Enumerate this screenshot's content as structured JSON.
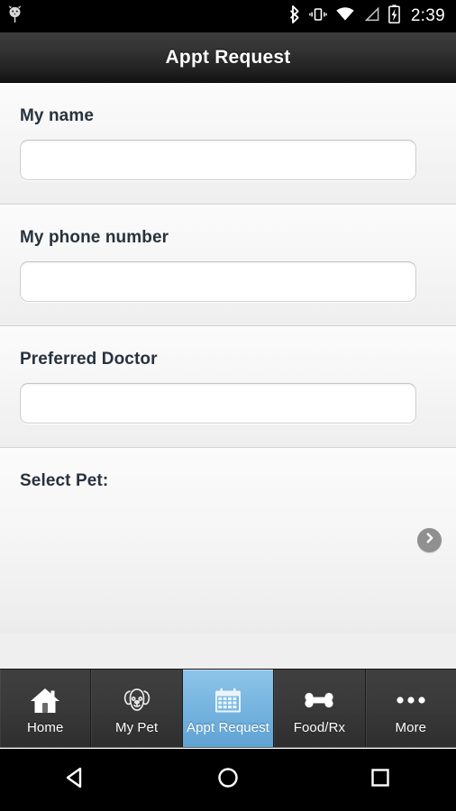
{
  "statusbar": {
    "notification_icon": "app-notification-icon",
    "icons": [
      "bluetooth-icon",
      "vibrate-icon",
      "wifi-icon",
      "cell-signal-icon",
      "battery-charging-icon"
    ],
    "time": "2:39"
  },
  "titlebar": {
    "title": "Appt Request"
  },
  "form": {
    "sections": [
      {
        "label": "My name",
        "value": "",
        "placeholder": ""
      },
      {
        "label": "My phone number",
        "value": "",
        "placeholder": ""
      },
      {
        "label": "Preferred Doctor",
        "value": "",
        "placeholder": ""
      }
    ],
    "select_pet": {
      "label": "Select Pet:",
      "arrow_icon": "chevron-right-icon"
    }
  },
  "tabbar": {
    "active_color": "#7ab8e2",
    "tabs": [
      {
        "label": "Home",
        "icon": "home-icon",
        "active": false
      },
      {
        "label": "My Pet",
        "icon": "dog-face-icon",
        "active": false
      },
      {
        "label": "Appt Request",
        "icon": "calendar-icon",
        "active": true
      },
      {
        "label": "Food/Rx",
        "icon": "bone-icon",
        "active": false
      },
      {
        "label": "More",
        "icon": "ellipsis-icon",
        "active": false
      }
    ]
  },
  "navbar": {
    "buttons": [
      {
        "name": "back",
        "icon": "triangle-left-icon"
      },
      {
        "name": "home",
        "icon": "circle-icon"
      },
      {
        "name": "recents",
        "icon": "square-icon"
      }
    ]
  }
}
